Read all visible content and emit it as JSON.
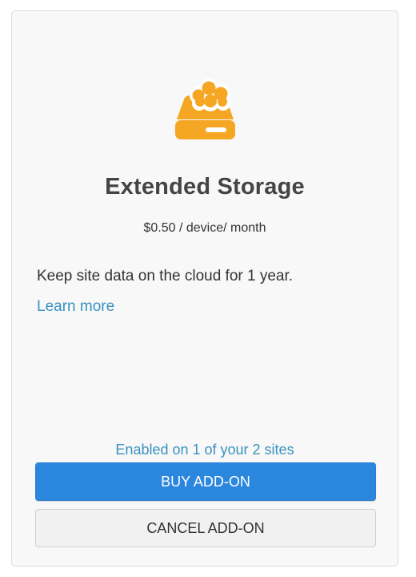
{
  "addon": {
    "icon": "cloud-storage-icon",
    "title": "Extended Storage",
    "price": "$0.50 / device/ month",
    "description": "Keep site data on the cloud for 1 year.",
    "learn_more_label": "Learn more",
    "enabled_status": "Enabled on 1 of your 2 sites",
    "buy_label": "BUY ADD-ON",
    "cancel_label": "CANCEL ADD-ON"
  },
  "colors": {
    "icon_orange": "#f5a623",
    "link_blue": "#3a91c0",
    "button_blue": "#2b87de",
    "title_gray": "#444444"
  }
}
